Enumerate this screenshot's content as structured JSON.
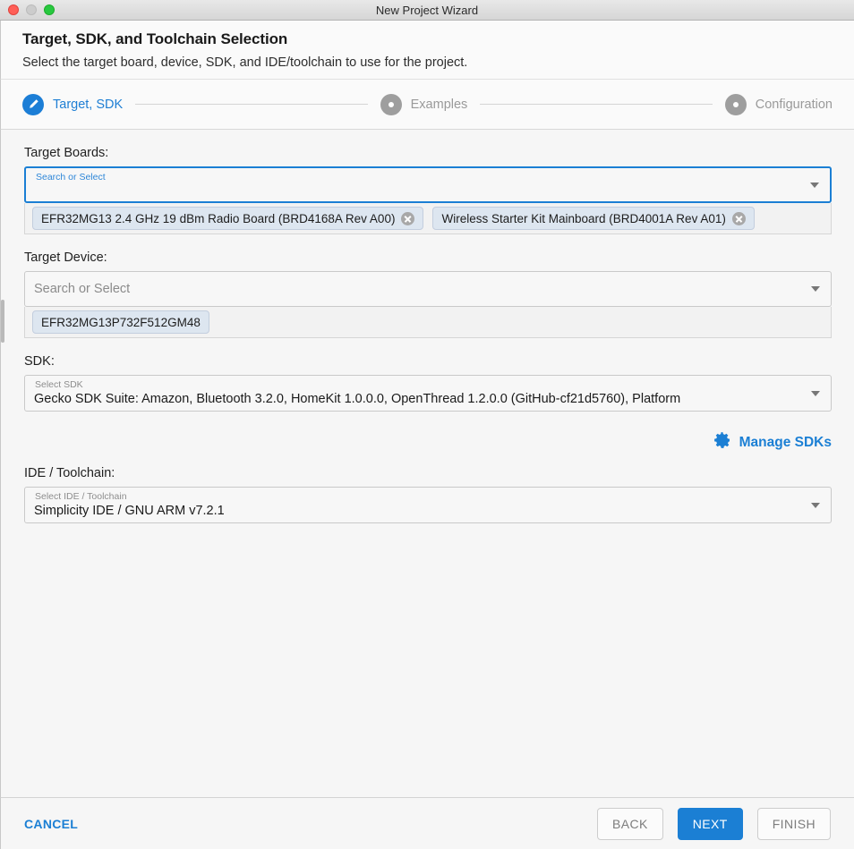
{
  "window": {
    "title": "New Project Wizard",
    "controls": {
      "close": "close-button",
      "minimize": "minimize-button",
      "zoom": "zoom-button"
    }
  },
  "header": {
    "title": "Target, SDK, and Toolchain Selection",
    "subtitle": "Select the target board, device, SDK, and IDE/toolchain to use for the project."
  },
  "stepper": {
    "steps": [
      {
        "label": "Target, SDK",
        "state": "active",
        "icon": "pencil-icon"
      },
      {
        "label": "Examples",
        "state": "idle",
        "icon": "dot-icon"
      },
      {
        "label": "Configuration",
        "state": "idle",
        "icon": "dot-icon"
      }
    ]
  },
  "target_boards": {
    "label": "Target Boards:",
    "placeholder": "Search or Select",
    "float_label": "Search or Select",
    "value": "",
    "focused": true,
    "chips": [
      "EFR32MG13 2.4 GHz 19 dBm Radio Board (BRD4168A Rev A00)",
      "Wireless Starter Kit Mainboard (BRD4001A Rev A01)"
    ]
  },
  "target_device": {
    "label": "Target Device:",
    "placeholder": "Search or Select",
    "value": "",
    "chips": [
      "EFR32MG13P732F512GM48"
    ]
  },
  "sdk": {
    "label": "SDK:",
    "float_label": "Select SDK",
    "value": "Gecko SDK Suite: Amazon, Bluetooth 3.2.0, HomeKit 1.0.0.0, OpenThread 1.2.0.0 (GitHub-cf21d5760), Platform",
    "manage_label": "Manage SDKs",
    "manage_icon": "gear-icon"
  },
  "toolchain": {
    "label": "IDE / Toolchain:",
    "float_label": "Select IDE / Toolchain",
    "value": "Simplicity IDE / GNU ARM v7.2.1"
  },
  "footer": {
    "cancel": "CANCEL",
    "back": "BACK",
    "next": "NEXT",
    "finish": "FINISH"
  },
  "colors": {
    "accent": "#1b7fd4",
    "chip_bg": "#dde6f0",
    "muted": "#9a9a9a"
  }
}
